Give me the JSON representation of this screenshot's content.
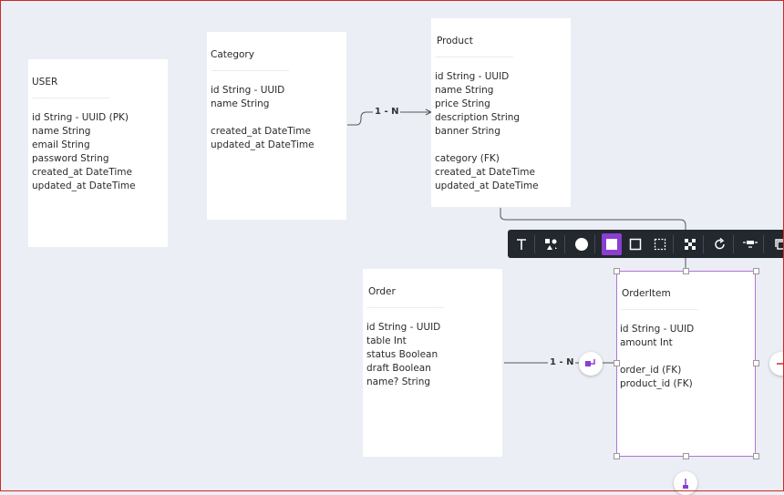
{
  "entities": {
    "user": {
      "title": "USER",
      "rule": "____________________",
      "fields": [
        "id String - UUID (PK)",
        "name String",
        "email String",
        "password String",
        "created_at DateTime",
        "updated_at DateTime"
      ]
    },
    "category": {
      "title": "Category",
      "rule": "____________________",
      "fields": [
        "id String - UUID",
        "name String",
        "",
        "created_at DateTime",
        "updated_at DateTime"
      ]
    },
    "product": {
      "title": "Product",
      "rule": "____________________",
      "fields": [
        "id String - UUID",
        "name String",
        "price String",
        "description String",
        "banner String",
        "",
        "category (FK)",
        "created_at DateTime",
        "updated_at DateTime"
      ]
    },
    "order": {
      "title": "Order",
      "rule": "____________________",
      "fields": [
        "id String - UUID",
        "table Int",
        "status Boolean",
        "draft Boolean",
        "name? String"
      ]
    },
    "orderitem": {
      "title": "OrderItem",
      "rule": "____________________",
      "fields": [
        "id String - UUID",
        "amount Int",
        "",
        "order_id (FK)",
        "product_id (FK)"
      ]
    }
  },
  "connectors": {
    "category_product": "1 - N",
    "order_orderitem": "1 - N"
  },
  "toolbar": {
    "tools": [
      "text-tool-icon",
      "shapes-icon",
      "color-circle-icon",
      "fill-solid-icon",
      "fill-outline-icon",
      "fill-dashed-icon",
      "fill-pattern-icon",
      "rotate-icon",
      "align-icon",
      "duplicate-icon"
    ],
    "accent": "#8a3fd1"
  }
}
